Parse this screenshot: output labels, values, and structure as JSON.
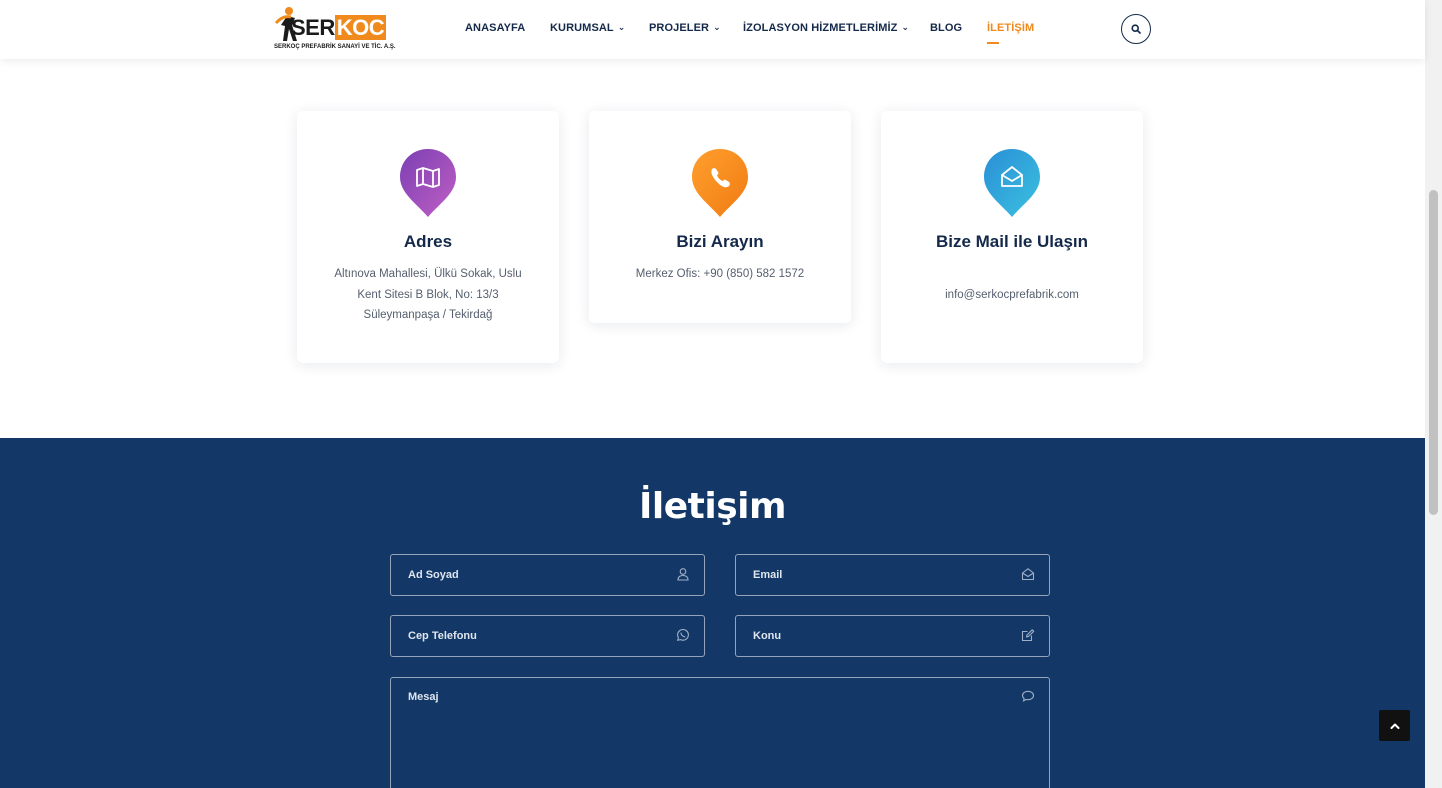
{
  "brand": {
    "name_part1": "SER",
    "name_part2": "KOC",
    "tagline": "SERKOÇ PREFABRİK SANAYİ VE TİC. A.Ş.",
    "accent": "#f08a1c",
    "navy": "#133766"
  },
  "nav": {
    "items": [
      {
        "label": "ANASAYFA"
      },
      {
        "label": "KURUMSAL",
        "has_dropdown": true
      },
      {
        "label": "PROJELER",
        "has_dropdown": true
      },
      {
        "label": "İZOLASYON HİZMETLERİMİZ",
        "has_dropdown": true
      },
      {
        "label": "BLOG"
      },
      {
        "label": "İLETİŞİM",
        "active": true
      }
    ],
    "search_icon": "search-icon"
  },
  "cards": [
    {
      "title": "Adres",
      "text": "Altınova Mahallesi, Ülkü Sokak, Uslu Kent Sitesi B Blok, No: 13/3 Süleymanpaşa / Tekirdağ",
      "icon": "map-icon",
      "color_from": "#7b3fb3",
      "color_to": "#c05fc4"
    },
    {
      "title": "Bizi Arayın",
      "text": "Merkez Ofis: +90 (850) 582 1572",
      "icon": "phone-icon",
      "color_from": "#ff9f2e",
      "color_to": "#f07b12"
    },
    {
      "title": "Bize Mail ile Ulaşın",
      "text": "info@serkocprefabrik.com",
      "icon": "envelope-open-icon",
      "color_from": "#2a8fd6",
      "color_to": "#3bc1e0"
    }
  ],
  "contact": {
    "title": "İletişim",
    "fields": {
      "name": {
        "placeholder": "Ad Soyad",
        "icon": "user-icon"
      },
      "email": {
        "placeholder": "Email",
        "icon": "envelope-open-icon"
      },
      "phone": {
        "placeholder": "Cep Telefonu",
        "icon": "whatsapp-icon"
      },
      "subject": {
        "placeholder": "Konu",
        "icon": "edit-icon"
      },
      "message": {
        "placeholder": "Mesaj",
        "icon": "comment-icon"
      }
    }
  }
}
